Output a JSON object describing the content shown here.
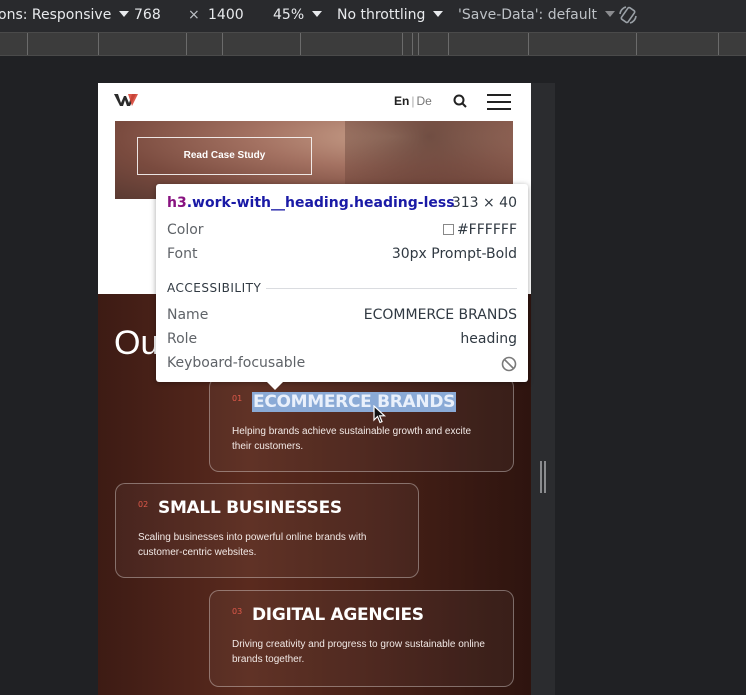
{
  "devtools_toolbar": {
    "dimensions_label": "ons: Responsive",
    "width": "768",
    "times": "×",
    "height": "1400",
    "zoom": "45%",
    "throttling": "No throttling",
    "save_data": "'Save-Data': default",
    "rotate_icon": "rotate-icon"
  },
  "site": {
    "logo_icon": "brand-logo-icon",
    "lang_en": "En",
    "lang_sep": "|",
    "lang_de": "De",
    "search_icon": "search-icon",
    "menu_icon": "hamburger-menu-icon",
    "case_study_button": "Read Case Study",
    "section_heading": "Ou",
    "cards": [
      {
        "number": "01",
        "title": "ECOMMERCE BRANDS",
        "description": "Helping brands achieve sustainable growth and excite their customers."
      },
      {
        "number": "02",
        "title": "SMALL BUSINESSES",
        "description": "Scaling businesses into powerful online brands with customer-centric websites."
      },
      {
        "number": "03",
        "title": "DIGITAL AGENCIES",
        "description": "Driving creativity and progress to grow sustainable online brands together."
      }
    ]
  },
  "inspect_tooltip": {
    "tag": "h3",
    "classes": ".work-with__heading.heading-less",
    "dimensions": "313 × 40",
    "color_label": "Color",
    "color_value": "#FFFFFF",
    "font_label": "Font",
    "font_value": "30px Prompt-Bold",
    "accessibility_header": "ACCESSIBILITY",
    "name_label": "Name",
    "name_value": "ECOMMERCE BRANDS",
    "role_label": "Role",
    "role_value": "heading",
    "focusable_label": "Keyboard-focusable",
    "focusable_icon": "not-allowed-icon"
  },
  "colors": {
    "accent_number": "#e0594a",
    "selection": "#8aaad6",
    "tag_purple": "#881280",
    "class_blue": "#1a1aa6"
  }
}
